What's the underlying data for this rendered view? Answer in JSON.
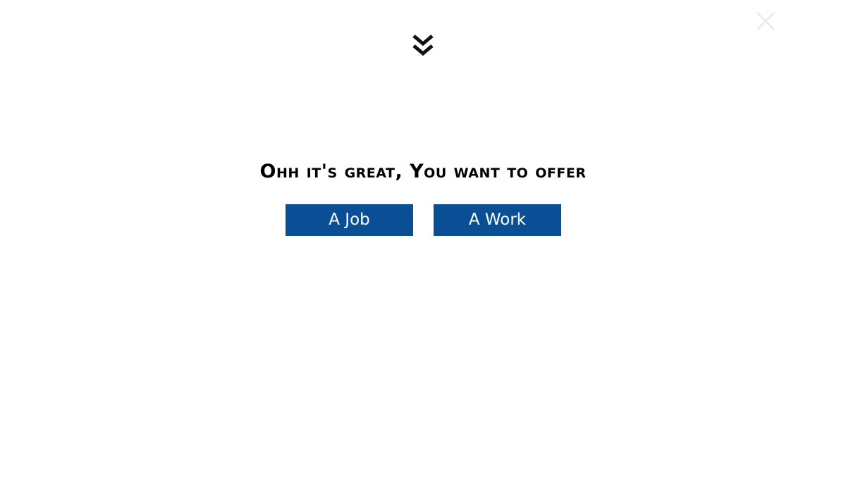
{
  "header": {
    "close_icon": "close-icon",
    "scroll_icon": "double-chevron-down-icon"
  },
  "main": {
    "heading": "Ohh it's great, You want to offer",
    "options": [
      {
        "label": "A Job"
      },
      {
        "label": "A Work"
      }
    ]
  },
  "colors": {
    "button_bg": "#0a4e96",
    "button_text": "#ffffff",
    "heading_text": "#000000",
    "close_icon": "#e6e6e6",
    "background": "#ffffff"
  }
}
